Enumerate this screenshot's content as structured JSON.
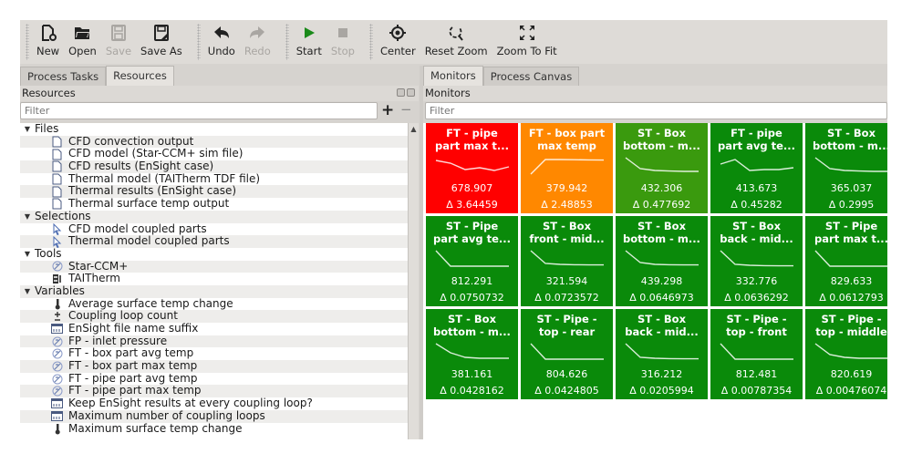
{
  "toolbar": {
    "buttons": [
      {
        "id": "new",
        "label": "New",
        "icon": "new-file-icon",
        "enabled": true
      },
      {
        "id": "open",
        "label": "Open",
        "icon": "folder-open-icon",
        "enabled": true
      },
      {
        "id": "save",
        "label": "Save",
        "icon": "save-icon",
        "enabled": false
      },
      {
        "id": "save_as",
        "label": "Save As",
        "icon": "save-as-icon",
        "enabled": true
      },
      {
        "id": "undo",
        "label": "Undo",
        "icon": "undo-icon",
        "enabled": true
      },
      {
        "id": "redo",
        "label": "Redo",
        "icon": "redo-icon",
        "enabled": false
      },
      {
        "id": "start",
        "label": "Start",
        "icon": "play-icon",
        "enabled": true
      },
      {
        "id": "stop",
        "label": "Stop",
        "icon": "stop-icon",
        "enabled": false
      },
      {
        "id": "center",
        "label": "Center",
        "icon": "target-icon",
        "enabled": true
      },
      {
        "id": "reset_zoom",
        "label": "Reset Zoom",
        "icon": "zoom-reset-icon",
        "enabled": true
      },
      {
        "id": "zoom_fit",
        "label": "Zoom To Fit",
        "icon": "zoom-fit-icon",
        "enabled": true
      }
    ]
  },
  "left": {
    "tabs": [
      {
        "label": "Process Tasks",
        "active": false
      },
      {
        "label": "Resources",
        "active": true
      }
    ],
    "panel_title": "Resources",
    "filter_placeholder": "Filter",
    "add_label": "+",
    "remove_label": "−",
    "tree": [
      {
        "type": "group",
        "label": "Files"
      },
      {
        "type": "leaf",
        "icon": "file",
        "label": "CFD convection output"
      },
      {
        "type": "leaf",
        "icon": "file",
        "label": "CFD model (Star-CCM+ sim file)"
      },
      {
        "type": "leaf",
        "icon": "file",
        "label": "CFD results (EnSight case)"
      },
      {
        "type": "leaf",
        "icon": "file",
        "label": "Thermal model (TAITherm TDF file)"
      },
      {
        "type": "leaf",
        "icon": "file",
        "label": "Thermal results (EnSight case)"
      },
      {
        "type": "leaf",
        "icon": "file",
        "label": "Thermal surface temp output"
      },
      {
        "type": "group",
        "label": "Selections"
      },
      {
        "type": "leaf",
        "icon": "pointer",
        "label": "CFD model coupled parts"
      },
      {
        "type": "leaf",
        "icon": "pointer",
        "label": "Thermal model coupled parts"
      },
      {
        "type": "group",
        "label": "Tools"
      },
      {
        "type": "leaf",
        "icon": "tool",
        "label": "Star-CCM+"
      },
      {
        "type": "leaf",
        "icon": "taitherm",
        "label": "TAITherm"
      },
      {
        "type": "group",
        "label": "Variables"
      },
      {
        "type": "leaf",
        "icon": "thermometer",
        "label": "Average surface temp change"
      },
      {
        "type": "leaf",
        "icon": "plusminus",
        "label": "Coupling loop count"
      },
      {
        "type": "leaf",
        "icon": "textfield",
        "label": "EnSight file name suffix"
      },
      {
        "type": "leaf",
        "icon": "tool",
        "label": "FP - inlet pressure"
      },
      {
        "type": "leaf",
        "icon": "tool",
        "label": "FT - box part avg temp"
      },
      {
        "type": "leaf",
        "icon": "tool",
        "label": "FT - box part max temp"
      },
      {
        "type": "leaf",
        "icon": "tool",
        "label": "FT - pipe part avg temp"
      },
      {
        "type": "leaf",
        "icon": "tool",
        "label": "FT - pipe part max temp"
      },
      {
        "type": "leaf",
        "icon": "textfield",
        "label": "Keep EnSight results at every coupling loop?"
      },
      {
        "type": "leaf",
        "icon": "textfield",
        "label": "Maximum number of coupling loops"
      },
      {
        "type": "leaf",
        "icon": "thermometer",
        "label": "Maximum surface temp change"
      }
    ]
  },
  "right": {
    "tabs": [
      {
        "label": "Monitors",
        "active": true
      },
      {
        "label": "Process Canvas",
        "active": false
      }
    ],
    "panel_title": "Monitors",
    "filter_placeholder": "Filter",
    "colors": {
      "red": "#ff0000",
      "orange": "#ff8800",
      "light_green": "#3a9a0e",
      "green": "#0a8a0a"
    },
    "monitors": [
      {
        "title": "FT - pipe\npart max t...",
        "value": "678.907",
        "delta": "Δ 3.64459",
        "status": "red",
        "trend": [
          0.8,
          0.65,
          0.3,
          0.4,
          0.25,
          0.45
        ]
      },
      {
        "title": "FT - box part\nmax temp",
        "value": "379.942",
        "delta": "Δ 2.48853",
        "status": "orange",
        "trend": [
          0.05,
          0.85,
          0.85,
          0.84,
          0.83,
          0.82
        ]
      },
      {
        "title": "ST - Box\nbottom - m...",
        "value": "432.306",
        "delta": "Δ 0.477692",
        "status": "light_green",
        "trend": [
          0.95,
          0.35,
          0.25,
          0.22,
          0.2,
          0.2
        ]
      },
      {
        "title": "FT - pipe\npart avg te...",
        "value": "413.673",
        "delta": "Δ 0.45282",
        "status": "green",
        "trend": [
          0.6,
          0.85,
          0.25,
          0.3,
          0.3,
          0.4
        ]
      },
      {
        "title": "ST - Box\nbottom - m...",
        "value": "365.037",
        "delta": "Δ 0.2995",
        "status": "green",
        "trend": [
          0.95,
          0.35,
          0.25,
          0.22,
          0.2,
          0.2
        ]
      },
      {
        "title": "ST - Pipe\npart avg te...",
        "value": "812.291",
        "delta": "Δ 0.0750732",
        "status": "green",
        "trend": [
          0.95,
          0.1,
          0.1,
          0.1,
          0.1,
          0.1
        ]
      },
      {
        "title": "ST - Box\nfront - mid...",
        "value": "321.594",
        "delta": "Δ 0.0723572",
        "status": "green",
        "trend": [
          0.95,
          0.25,
          0.2,
          0.18,
          0.17,
          0.17
        ]
      },
      {
        "title": "ST - Box\nbottom - m...",
        "value": "439.298",
        "delta": "Δ 0.0646973",
        "status": "green",
        "trend": [
          0.95,
          0.3,
          0.2,
          0.18,
          0.17,
          0.17
        ]
      },
      {
        "title": "ST - Box\nback - mid...",
        "value": "332.776",
        "delta": "Δ 0.0636292",
        "status": "green",
        "trend": [
          0.95,
          0.2,
          0.15,
          0.13,
          0.12,
          0.12
        ]
      },
      {
        "title": "ST - Pipe\npart max t...",
        "value": "829.633",
        "delta": "Δ 0.0612793",
        "status": "green",
        "trend": [
          0.95,
          0.1,
          0.1,
          0.1,
          0.1,
          0.1
        ]
      },
      {
        "title": "ST - Box\nbottom - m...",
        "value": "381.161",
        "delta": "Δ 0.0428162",
        "status": "green",
        "trend": [
          0.95,
          0.45,
          0.2,
          0.15,
          0.15,
          0.15
        ]
      },
      {
        "title": "ST - Pipe -\ntop - rear",
        "value": "804.626",
        "delta": "Δ 0.0424805",
        "status": "green",
        "trend": [
          0.95,
          0.1,
          0.1,
          0.1,
          0.1,
          0.1
        ]
      },
      {
        "title": "ST - Box\nback - mid...",
        "value": "316.212",
        "delta": "Δ 0.0205994",
        "status": "green",
        "trend": [
          0.95,
          0.2,
          0.15,
          0.13,
          0.12,
          0.12
        ]
      },
      {
        "title": "ST - Pipe -\ntop - front",
        "value": "812.481",
        "delta": "Δ 0.00787354",
        "status": "green",
        "trend": [
          0.95,
          0.1,
          0.1,
          0.1,
          0.1,
          0.1
        ]
      },
      {
        "title": "ST - Pipe -\ntop - middle",
        "value": "820.619",
        "delta": "Δ 0.00476074",
        "status": "green",
        "trend": [
          0.95,
          0.35,
          0.2,
          0.15,
          0.15,
          0.15
        ]
      }
    ]
  }
}
